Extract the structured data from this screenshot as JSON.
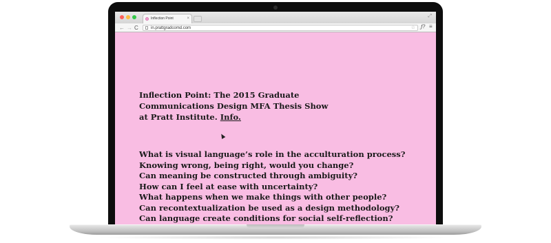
{
  "browser": {
    "tab_title": "Inflection Point",
    "tab_close": "×",
    "url": "in.prattgradcomd.com",
    "nav": {
      "back": "←",
      "forward": "→",
      "reload": "C"
    },
    "star": "☆",
    "extension": "ƒ?",
    "menu": "≡",
    "fullscreen": "⤢"
  },
  "page": {
    "intro_lines": [
      "Inflection Point: The 2015 Graduate",
      "Communications Design MFA Thesis Show",
      "at Pratt Institute."
    ],
    "info_link": "Info.",
    "questions": [
      "What is visual language’s role in the acculturation process?",
      "Knowing wrong, being right, would you change?",
      "Can meaning be constructed through ambiguity?",
      "How can I feel at ease with uncertainty?",
      "What happens when we make things with other people?",
      "Can recontextualization be used as a design methodology?",
      "Can language create conditions for social self-reflection?"
    ]
  },
  "colors": {
    "page_background": "#f9bde3",
    "text": "#1a1a1a"
  }
}
